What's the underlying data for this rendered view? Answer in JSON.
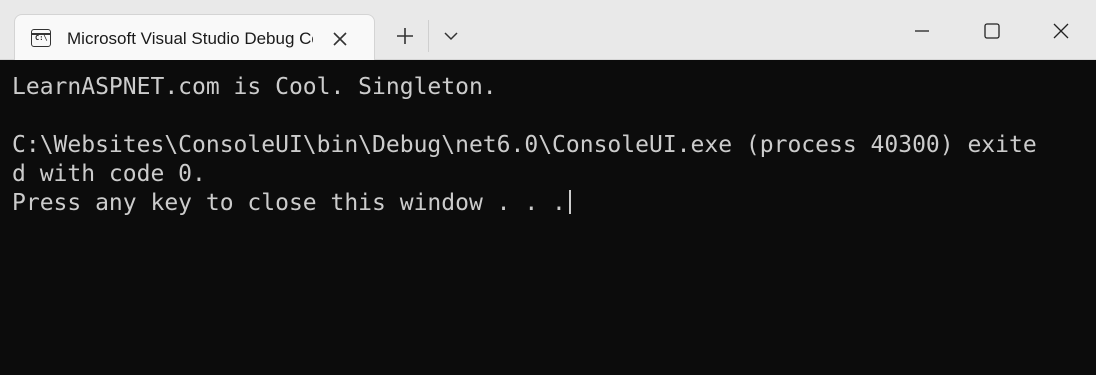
{
  "window": {
    "tab_title": "Microsoft Visual Studio Debug Console",
    "tab_icon": "console-icon",
    "new_tab_icon": "plus-icon",
    "dropdown_icon": "chevron-down-icon",
    "minimize_icon": "minimize-icon",
    "maximize_icon": "maximize-icon",
    "close_icon": "close-icon",
    "prompt_glyph": "C:\\"
  },
  "console": {
    "lines": [
      "LearnASPNET.com is Cool. Singleton.",
      "",
      "C:\\Websites\\ConsoleUI\\bin\\Debug\\net6.0\\ConsoleUI.exe (process 40300) exite",
      "d with code 0.",
      "Press any key to close this window . . ."
    ]
  },
  "colors": {
    "console_bg": "#0c0c0c",
    "console_fg": "#cccccc",
    "titlebar_bg": "#e9e9e9",
    "tab_bg": "#f9f9f9"
  }
}
